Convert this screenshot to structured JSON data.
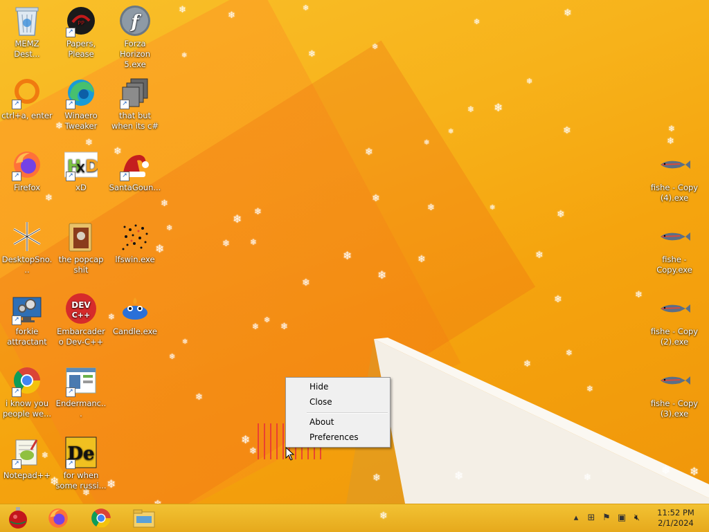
{
  "desktop": {
    "icons": [
      {
        "label": "MEMZ Dest...",
        "icon": "recycle-bin-icon"
      },
      {
        "label": "Papers, Please",
        "icon": "papers-please-icon"
      },
      {
        "label": "Forza Horizon 5.exe",
        "icon": "flash-player-icon"
      },
      {
        "label": "ctrl+a, enter",
        "icon": "ring-icon"
      },
      {
        "label": "Winaero Tweaker",
        "icon": "edge-icon"
      },
      {
        "label": "that but when its c#",
        "icon": "stacked-windows-icon"
      },
      {
        "label": "Firefox",
        "icon": "firefox-icon"
      },
      {
        "label": "xD",
        "icon": "hxd-icon"
      },
      {
        "label": "SantaGoun...",
        "icon": "santa-hat-icon"
      },
      {
        "label": "DesktopSno...",
        "icon": "snowflake-icon"
      },
      {
        "label": "the popcap shit",
        "icon": "folder-icon"
      },
      {
        "label": "lfswin.exe",
        "icon": "dots-icon"
      },
      {
        "label": "forkie attractant",
        "icon": "monitor-gear-icon"
      },
      {
        "label": "Embarcadero Dev-C++",
        "icon": "devcpp-icon"
      },
      {
        "label": "Candle.exe",
        "icon": "candle-icon"
      },
      {
        "label": "i know you people we...",
        "icon": "chrome-icon"
      },
      {
        "label": "Endermanc...",
        "icon": "app-window-icon"
      },
      {
        "label": "Notepad++",
        "icon": "notepadpp-icon"
      },
      {
        "label": "for when some russi...",
        "icon": "de-icon"
      },
      {
        "label": "fishe - Copy (4).exe",
        "icon": "fish-icon"
      },
      {
        "label": "fishe - Copy.exe",
        "icon": "fish-icon"
      },
      {
        "label": "fishe - Copy (2).exe",
        "icon": "fish-icon"
      },
      {
        "label": "fishe - Copy (3).exe",
        "icon": "fish-icon"
      }
    ]
  },
  "context_menu": {
    "items": [
      "Hide",
      "Close",
      "About",
      "Preferences"
    ]
  },
  "taskbar": {
    "pinned": [
      "ornament-start-icon",
      "firefox-icon",
      "chrome-icon",
      "file-explorer-icon"
    ],
    "tray": [
      "show-hidden-icon",
      "network-device-icon",
      "action-center-flag-icon",
      "network-icon",
      "volume-muted-icon"
    ],
    "time": "11:52 PM",
    "date": "2/1/2024"
  },
  "colors": {
    "accent": "#f5a40e",
    "taskbar": "#e6a91c"
  }
}
